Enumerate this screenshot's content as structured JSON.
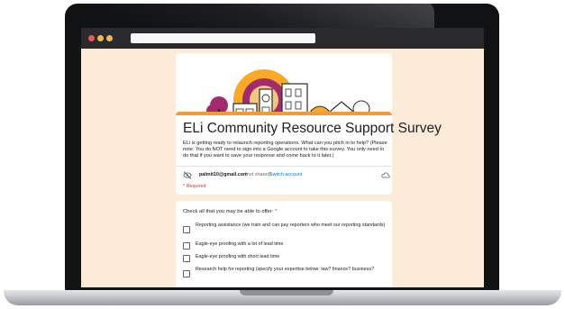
{
  "form": {
    "title": "ELi Community Resource Support Survey",
    "description": "ELi is getting ready to relaunch reporting operations. What can you pitch in to help? (Please note: You do NOT need to sign into a Google account to take this survey. You only need to do that if you want to save your response and come back to it later.)",
    "account": {
      "email": "palmit10@gmail.com",
      "shared_note": "(not shared)",
      "switch_label": "Switch account"
    },
    "required_note": "* Required"
  },
  "question": {
    "label": "Check all that you may be able to offer:",
    "required_mark": "*",
    "options": [
      "Reporting assistance (we train and can pay reporters who meet our reporting standards)",
      "Eagle-eye proofing with a lot of lead time",
      "Eagle-eye proofing with short lead time",
      "Research help for reporting (specify your expertise below: law? finance? business?"
    ]
  },
  "colors": {
    "accent": "#f39a3a",
    "link": "#1a73e8",
    "required": "#d93025",
    "page_bg": "#fbebd8"
  }
}
